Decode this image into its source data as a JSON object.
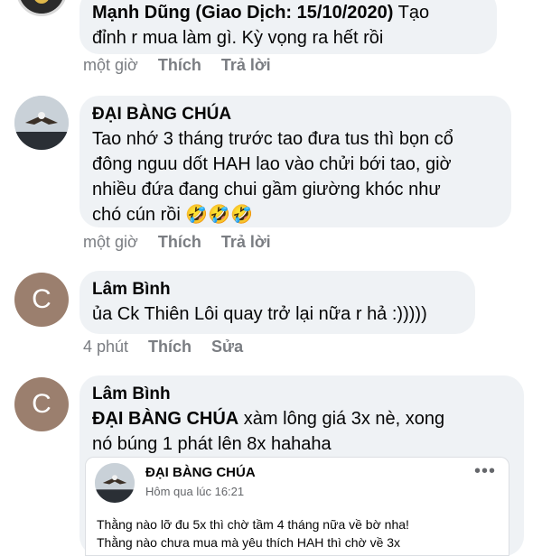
{
  "comments": [
    {
      "author": "Mạnh Dũng (Giao Dịch: 15/10/2020)",
      "text_inline": "Tạo",
      "text_line2": "đỉnh r mua làm gì. Kỳ vọng ra hết rồi",
      "time": "một giờ",
      "like": "Thích",
      "reply": "Trả lời"
    },
    {
      "author": "ĐẠI BÀNG CHÚA",
      "lines": [
        "Tao nhớ 3 tháng trước tao đưa tus thì bọn cổ",
        "đông nguu dốt HAH lao vào chửi bới tao, giờ",
        "nhiều đứa đang chui gầm giường khóc như",
        "chó cún rồi 🤣🤣🤣"
      ],
      "time": "một giờ",
      "like": "Thích",
      "reply": "Trả lời"
    },
    {
      "author": "Lâm Bình",
      "avatar_letter": "C",
      "text": "ủa Ck Thiên Lôi quay trở lại nữa r hả :)))))",
      "time": "4 phút",
      "like": "Thích",
      "edit": "Sửa"
    },
    {
      "author": "Lâm Bình",
      "avatar_letter": "C",
      "mention": "ĐẠI BÀNG CHÚA",
      "text_inline": "xàm lông giá 3x nè, xong",
      "text_line2": "nó búng 1 phát lên 8x hahaha",
      "shared_post": {
        "author": "ĐẠI BÀNG CHÚA",
        "timestamp": "Hôm qua lúc 16:21",
        "menu": "•••",
        "lines": [
          "Thằng nào lỡ đu 5x thì chờ tầm 4 tháng nữa về bờ nha!",
          "Thằng nào chưa mua mà yêu thích HAH thì chờ về 3x"
        ]
      }
    }
  ]
}
